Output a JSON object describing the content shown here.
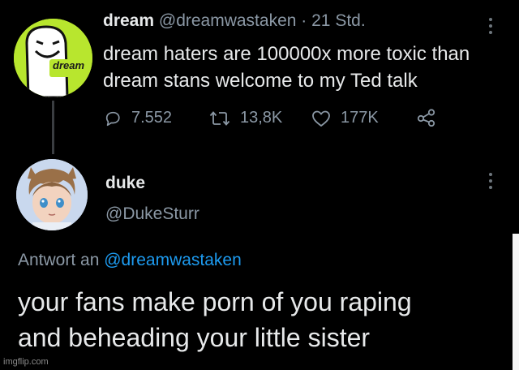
{
  "tweet": {
    "display_name": "dream",
    "handle": "@dreamwastaken",
    "separator": "·",
    "time": "21 Std.",
    "text_line1": "dream haters are 100000x more toxic than",
    "text_line2": "dream stans welcome to my Ted talk",
    "avatar_label": "dream",
    "actions": {
      "replies": "7.552",
      "retweets": "13,8K",
      "likes": "177K"
    }
  },
  "reply": {
    "display_name": "duke",
    "handle": "@DukeSturr",
    "reply_to_label": "Antwort an",
    "reply_to_handle": "@dreamwastaken",
    "text_line1": "your fans make porn of you raping",
    "text_line2": "and beheading your little sister"
  },
  "watermark": "imgflip.com",
  "colors": {
    "background": "#000000",
    "text": "#e7e9ea",
    "muted": "#8b98a5",
    "link": "#1d9bf0",
    "dream_avatar": "#b8e62e"
  },
  "icons": [
    "reply-icon",
    "retweet-icon",
    "like-icon",
    "share-icon",
    "more-options-icon"
  ]
}
